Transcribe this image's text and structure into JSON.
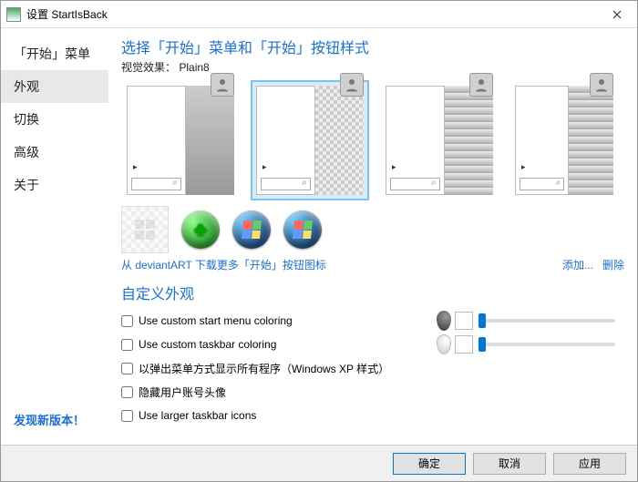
{
  "window": {
    "title": "设置 StartIsBack"
  },
  "sidebar": {
    "items": [
      {
        "label": "「开始」菜单"
      },
      {
        "label": "外观"
      },
      {
        "label": "切换"
      },
      {
        "label": "高级"
      },
      {
        "label": "关于"
      }
    ],
    "update_notice": "发现新版本！"
  },
  "content": {
    "heading": "选择「开始」菜单和「开始」按钮样式",
    "visual_label": "视觉效果：",
    "visual_value": "Plain8",
    "deviantart_link": "从 deviantART 下载更多「开始」按钮图标",
    "add_link": "添加...",
    "remove_link": "删除",
    "customize_heading": "自定义外观",
    "options": {
      "custom_menu_color": "Use custom start menu coloring",
      "custom_taskbar_color": "Use custom taskbar coloring",
      "xp_style": "以弹出菜单方式显示所有程序（Windows XP 样式）",
      "hide_avatar": "隐藏用户账号头像",
      "larger_icons": "Use larger taskbar icons"
    }
  },
  "footer": {
    "ok": "确定",
    "cancel": "取消",
    "apply": "应用"
  }
}
